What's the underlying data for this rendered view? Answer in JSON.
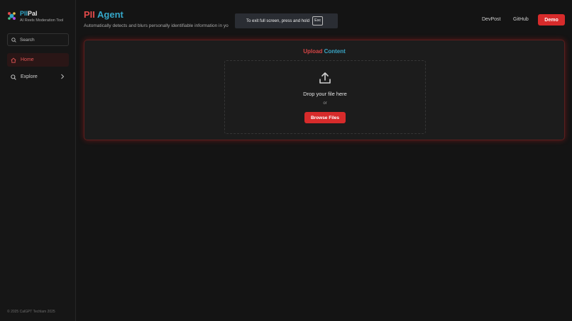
{
  "brand": {
    "name_part1": "PII",
    "name_part2": "Pal",
    "tagline": "AI Reels Moderation Tool"
  },
  "sidebar": {
    "search_placeholder": "Search",
    "items": [
      {
        "label": "Home",
        "icon": "home-icon",
        "active": true
      },
      {
        "label": "Explore",
        "icon": "search-icon",
        "active": false
      }
    ],
    "footer": "© 2025 CalGPT Techlam 2025"
  },
  "header": {
    "title_part1": "PII",
    "title_part2": "Agent",
    "subtitle": "Automatically detects and blurs personally identifiable information in yo"
  },
  "toast": {
    "text": "To exit full screen, press and hold",
    "key": "Esc"
  },
  "topnav": {
    "devpost": "DevPost",
    "github": "GitHub",
    "demo": "Demo"
  },
  "upload": {
    "title_part1": "Upload",
    "title_part2": "Content",
    "drop_text": "Drop your file here",
    "or_text": "or",
    "browse_label": "Browse Files"
  },
  "colors": {
    "accent_red": "#d72b2b",
    "accent_blue": "#35a7c9",
    "background": "#141414"
  }
}
